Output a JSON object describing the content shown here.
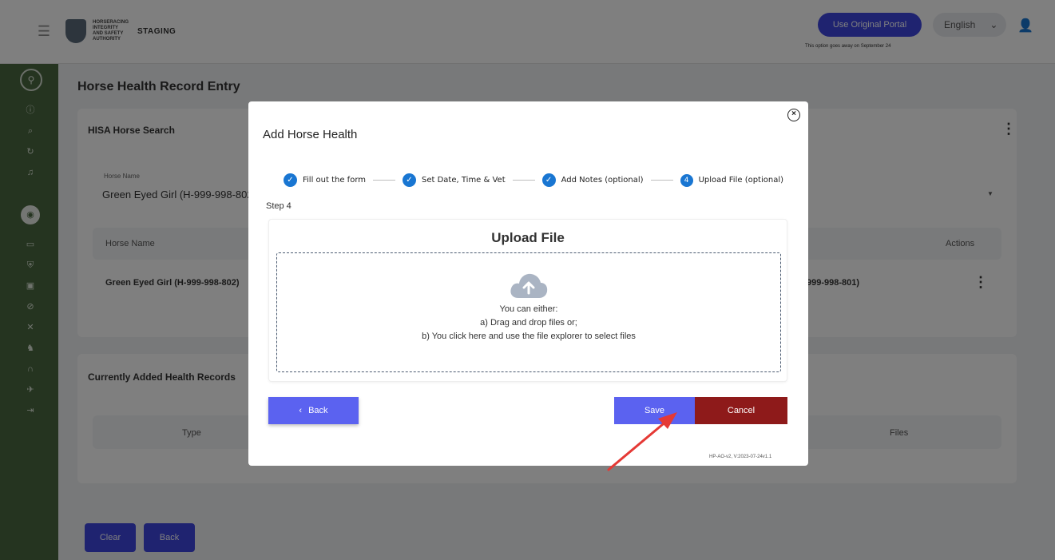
{
  "header": {
    "logo_text": "Horseracing Integrity and Safety Authority",
    "env_label": "STAGING",
    "original_portal_button": "Use Original Portal",
    "original_portal_note": "This option goes away on September 24",
    "language": "English"
  },
  "page": {
    "title": "Horse Health Record Entry",
    "search_card_title": "HISA Horse Search",
    "horse_name_label": "Horse Name",
    "horse_name_value": "Green Eyed Girl (H-999-998-802)",
    "table_header_name": "Horse Name",
    "table_header_actions": "Actions",
    "row_horse_name": "Green Eyed Girl (H-999-998-802)",
    "row_partial_id": "999-998-801)",
    "records_card_title": "Currently Added Health Records",
    "records_header_type": "Type",
    "records_header_files": "Files",
    "clear_button": "Clear",
    "back_button": "Back"
  },
  "modal": {
    "title": "Add Horse Health",
    "steps": [
      {
        "label": "Fill out the form",
        "status": "complete"
      },
      {
        "label": "Set Date, Time & Vet",
        "status": "complete"
      },
      {
        "label": "Add Notes (optional)",
        "status": "complete"
      },
      {
        "label": "Upload File (optional)",
        "status": "active",
        "number": "4"
      }
    ],
    "step_caption": "Step 4",
    "upload_title": "Upload File",
    "dropzone_line1": "You can either:",
    "dropzone_line2": "a) Drag and drop files or;",
    "dropzone_line3": "b) You click here and use the file explorer to select files",
    "back_button": "Back",
    "save_button": "Save",
    "cancel_button": "Cancel",
    "version": "HP-AO-v2, V:2023-07-24v1.1"
  },
  "colors": {
    "primary": "#3e46e0",
    "sidebar": "#4a6840",
    "cancel": "#8e1a1a",
    "step": "#1976d2",
    "annotation_arrow": "#e53935"
  }
}
